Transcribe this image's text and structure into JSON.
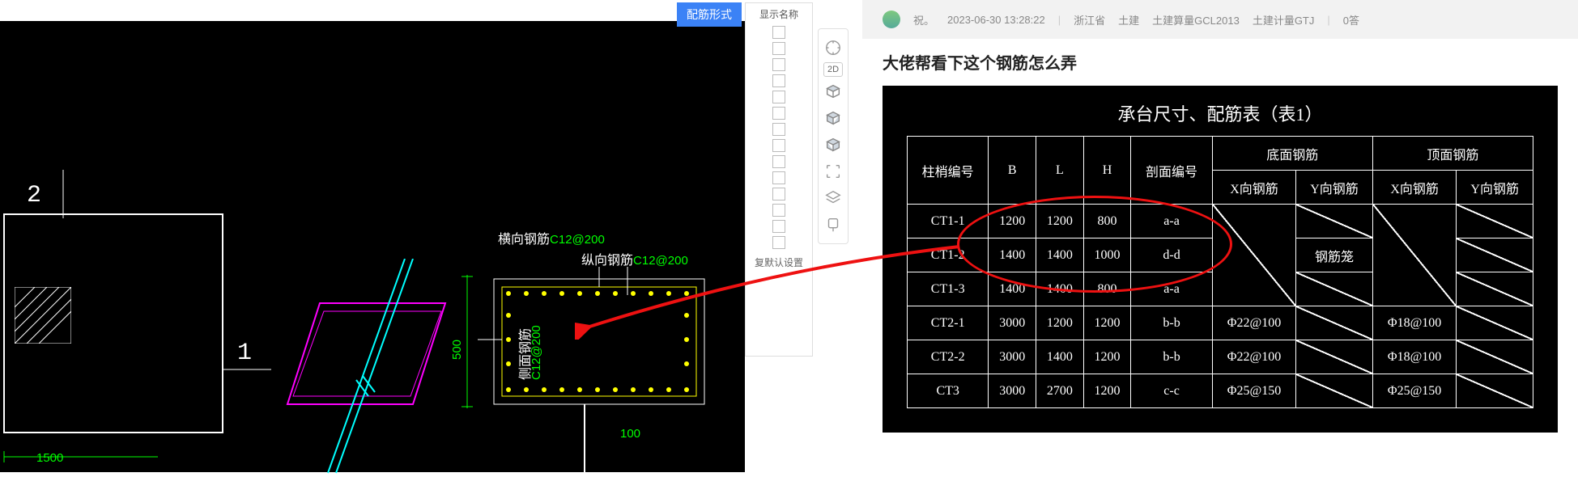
{
  "left": {
    "button_label": "配筋形式",
    "panel_header": "显示名称",
    "reset_label": "复默认设置",
    "labels": {
      "hengxiang": "横向钢筋",
      "hengxiang_spec": "C12@200",
      "zongxiang": "纵向钢筋",
      "zongxiang_spec": "C12@200",
      "cemian": "侧面钢筋",
      "cemian_spec": "C12@200",
      "num1": "1",
      "num2": "2",
      "dim500": "500",
      "dim100": "100",
      "dim1500": "1500"
    },
    "tool_icons": [
      "compass-icon",
      "2d-icon",
      "box-top-icon",
      "box-front-icon",
      "box-side-icon",
      "focus-icon",
      "layers-icon",
      "pin-icon"
    ]
  },
  "forum": {
    "user": "祝。",
    "timestamp": "2023-06-30 13:28:22",
    "province": "浙江省",
    "software1": "土建",
    "software2": "土建算量GCL2013",
    "software3": "土建计量GTJ",
    "replies": "0答",
    "title": "大佬帮看下这个钢筋怎么弄"
  },
  "table": {
    "caption": "承台尺寸、配筋表（表1）",
    "head": {
      "col1": "柱梢编号",
      "col2": "B",
      "col3": "L",
      "col4": "H",
      "col5": "剖面编号",
      "group_bottom": "底面钢筋",
      "group_top": "顶面钢筋",
      "sub_x": "X向钢筋",
      "sub_y": "Y向钢筋"
    },
    "rows": [
      {
        "id": "CT1-1",
        "B": "1200",
        "L": "1200",
        "H": "800",
        "sec": "a-a",
        "bx": "",
        "by": "",
        "tx": "",
        "ty": ""
      },
      {
        "id": "CT1-2",
        "B": "1400",
        "L": "1400",
        "H": "1000",
        "sec": "d-d",
        "bx": "",
        "by": "钢筋笼",
        "tx": "",
        "ty": ""
      },
      {
        "id": "CT1-3",
        "B": "1400",
        "L": "1400",
        "H": "800",
        "sec": "a-a",
        "bx": "",
        "by": "",
        "tx": "",
        "ty": ""
      },
      {
        "id": "CT2-1",
        "B": "3000",
        "L": "1200",
        "H": "1200",
        "sec": "b-b",
        "bx": "Φ22@100",
        "by": "",
        "tx": "Φ18@100",
        "ty": ""
      },
      {
        "id": "CT2-2",
        "B": "3000",
        "L": "1400",
        "H": "1200",
        "sec": "b-b",
        "bx": "Φ22@100",
        "by": "",
        "tx": "Φ18@100",
        "ty": ""
      },
      {
        "id": "CT3",
        "B": "3000",
        "L": "2700",
        "H": "1200",
        "sec": "c-c",
        "bx": "Φ25@150",
        "by": "",
        "tx": "Φ25@150",
        "ty": ""
      }
    ]
  },
  "chart_data": {
    "type": "table",
    "title": "承台尺寸、配筋表（表1）",
    "columns": [
      "柱梢编号",
      "B",
      "L",
      "H",
      "剖面编号",
      "底面X向钢筋",
      "底面Y向钢筋",
      "顶面X向钢筋",
      "顶面Y向钢筋"
    ],
    "rows": [
      [
        "CT1-1",
        1200,
        1200,
        800,
        "a-a",
        "",
        "",
        "",
        ""
      ],
      [
        "CT1-2",
        1400,
        1400,
        1000,
        "d-d",
        "",
        "钢筋笼",
        "",
        ""
      ],
      [
        "CT1-3",
        1400,
        1400,
        800,
        "a-a",
        "",
        "",
        "",
        ""
      ],
      [
        "CT2-1",
        3000,
        1200,
        1200,
        "b-b",
        "Φ22@100",
        "",
        "Φ18@100",
        ""
      ],
      [
        "CT2-2",
        3000,
        1400,
        1200,
        "b-b",
        "Φ22@100",
        "",
        "Φ18@100",
        ""
      ],
      [
        "CT3",
        3000,
        2700,
        1200,
        "c-c",
        "Φ25@150",
        "",
        "Φ25@150",
        ""
      ]
    ]
  }
}
